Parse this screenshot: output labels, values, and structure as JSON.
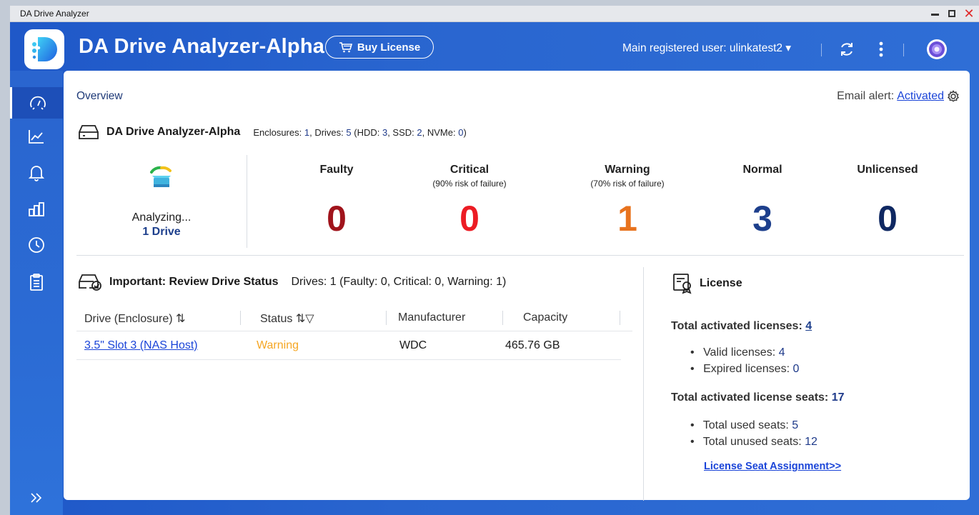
{
  "window": {
    "title": "DA Drive Analyzer"
  },
  "header": {
    "app_title": "DA Drive Analyzer-Alpha",
    "buy_label": "Buy License",
    "user_menu": "Main registered user: ulinkatest2 ▾"
  },
  "overview": {
    "label": "Overview",
    "email_alert_label": "Email alert:",
    "email_alert_value": "Activated"
  },
  "summary": {
    "title": "DA Drive Analyzer-Alpha",
    "t1": "Enclosures: ",
    "enclosures": "1",
    "t2": ", Drives: ",
    "drives": "5",
    "t3": " (HDD: ",
    "hdd": "3",
    "t4": ", SSD: ",
    "ssd": "2",
    "t5": ", NVMe: ",
    "nvme": "0",
    "t6": ")"
  },
  "analyzing": {
    "label": "Analyzing...",
    "count": "1 Drive"
  },
  "stats": [
    {
      "label": "Faulty",
      "sub": "",
      "value": "0",
      "color": "#a0141c"
    },
    {
      "label": "Critical",
      "sub": "(90% risk of failure)",
      "value": "0",
      "color": "#ec1c24"
    },
    {
      "label": "Warning",
      "sub": "(70% risk of failure)",
      "value": "1",
      "color": "#e8731e"
    },
    {
      "label": "Normal",
      "sub": "",
      "value": "3",
      "color": "#1d3f8c"
    },
    {
      "label": "Unlicensed",
      "sub": "",
      "value": "0",
      "color": "#0f2862"
    }
  ],
  "review": {
    "title": "Important: Review Drive Status",
    "detail": "Drives: 1 (Faulty: 0, Critical: 0, Warning: 1)"
  },
  "table": {
    "columns": [
      "Drive (Enclosure)",
      "Status",
      "Manufacturer",
      "Capacity"
    ],
    "rows": [
      {
        "drive": "3.5\" Slot 3 (NAS Host)",
        "status": "Warning",
        "manufacturer": "WDC",
        "capacity": "465.76 GB"
      }
    ]
  },
  "license": {
    "title": "License",
    "total_activated_label": "Total activated licenses: ",
    "total_activated": "4",
    "valid_label": "Valid licenses: ",
    "valid": "4",
    "expired_label": "Expired licenses: ",
    "expired": "0",
    "seats_label": "Total activated license seats: ",
    "seats": "17",
    "used_label": "Total used seats: ",
    "used": "5",
    "unused_label": "Total unused seats: ",
    "unused": "12",
    "link": "License Seat Assignment>>"
  },
  "colors": {
    "accent": "#2965cf",
    "link": "#1a44d8",
    "warning": "#f5a623"
  }
}
